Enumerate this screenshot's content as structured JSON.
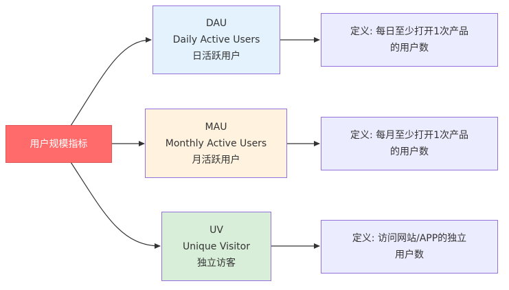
{
  "root": {
    "label": "用户规模指标",
    "fill": "#ff6b6b",
    "stroke": "#e05555",
    "text_color": "#ffffff"
  },
  "metrics": [
    {
      "id": "dau",
      "abbr": "DAU",
      "full": "Daily Active Users",
      "cn": "日活跃用户",
      "fill": "#e3f2fd",
      "stroke": "#9370db",
      "definition_line1": "定义: 每日至少打开1次产品",
      "definition_line2": "的用户数"
    },
    {
      "id": "mau",
      "abbr": "MAU",
      "full": "Monthly Active Users",
      "cn": "月活跃用户",
      "fill": "#fff3e0",
      "stroke": "#9370db",
      "definition_line1": "定义: 每月至少打开1次产品",
      "definition_line2": "的用户数"
    },
    {
      "id": "uv",
      "abbr": "UV",
      "full": "Unique Visitor",
      "cn": "独立访客",
      "fill": "#d8eed8",
      "stroke": "#9370db",
      "definition_line1": "定义: 访问网站/APP的独立",
      "definition_line2": "用户数"
    }
  ],
  "definition_style": {
    "fill": "#ececff",
    "stroke": "#9370db"
  },
  "edge_color": "#333333"
}
